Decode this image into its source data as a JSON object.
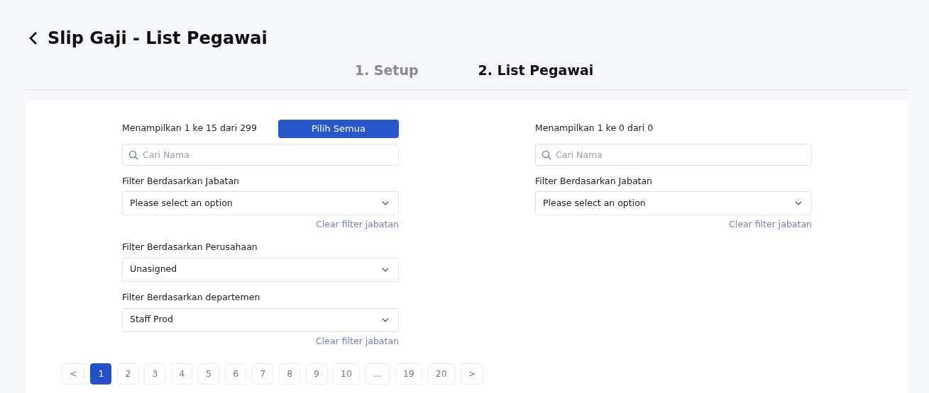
{
  "header": {
    "title": "Slip Gaji - List Pegawai"
  },
  "steps": [
    {
      "label": "1. Setup",
      "selected": false
    },
    {
      "label": "2. List Pegawai",
      "selected": true
    }
  ],
  "panels": [
    {
      "summary": "Menampilkan 1 ke 15 dari 299",
      "select_all_button": "Pilih Semua",
      "search": {
        "placeholder": "Cari Nama"
      },
      "filters": [
        {
          "label": "Filter Berdasarkan Jabatan",
          "value": "Please select an option",
          "clear_link": "Clear filter jabatan"
        },
        {
          "label": "Filter Berdasarkan Perusahaan",
          "value": "Unasigned"
        },
        {
          "label": "Filter Berdasarkan departemen",
          "value": "Staff Prod",
          "clear_link": "Clear filter jabatan"
        }
      ]
    },
    {
      "summary": "Menampilkan 1 ke 0 dari 0",
      "search": {
        "placeholder": "Cari Nama"
      },
      "filters": [
        {
          "label": "Filter Berdasarkan Jabatan",
          "value": "Please select an option",
          "clear_link": "Clear filter jabatan"
        }
      ]
    }
  ],
  "pagination": [
    {
      "label": "<",
      "selected": false
    },
    {
      "label": "1",
      "selected": true
    },
    {
      "label": "2",
      "selected": false
    },
    {
      "label": "3",
      "selected": false
    },
    {
      "label": "4",
      "selected": false
    },
    {
      "label": "5",
      "selected": false
    },
    {
      "label": "6",
      "selected": false
    },
    {
      "label": "7",
      "selected": false
    },
    {
      "label": "8",
      "selected": false
    },
    {
      "label": "9",
      "selected": false
    },
    {
      "label": "10",
      "selected": false
    },
    {
      "label": "...",
      "selected": false
    },
    {
      "label": "19",
      "selected": false
    },
    {
      "label": "20",
      "selected": false
    },
    {
      "label": ">",
      "selected": false
    }
  ]
}
